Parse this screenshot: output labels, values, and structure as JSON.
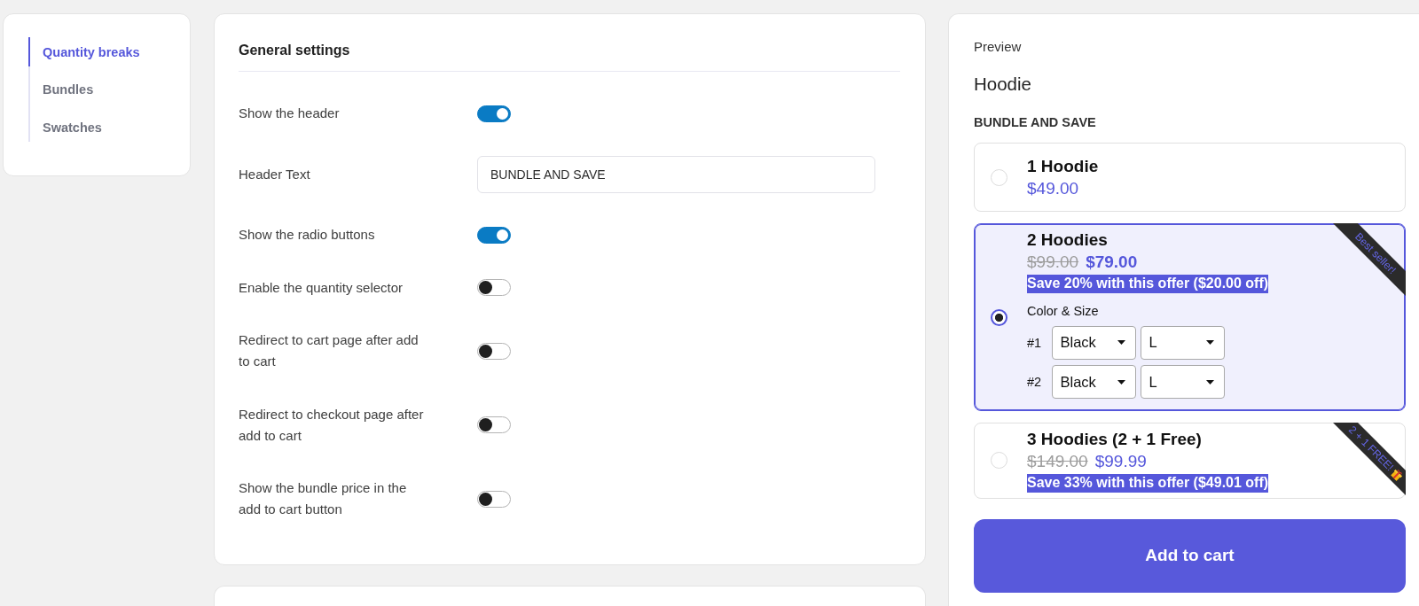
{
  "sidebar": {
    "items": [
      {
        "label": "Quantity breaks",
        "selected": true
      },
      {
        "label": "Bundles",
        "selected": false
      },
      {
        "label": "Swatches",
        "selected": false
      }
    ]
  },
  "settings": {
    "title": "General settings",
    "rows": [
      {
        "kind": "toggle",
        "label": "Show the header",
        "on": true
      },
      {
        "kind": "text",
        "label": "Header Text",
        "value": "BUNDLE AND SAVE"
      },
      {
        "kind": "toggle",
        "label": "Show the radio buttons",
        "on": true
      },
      {
        "kind": "toggle",
        "label": "Enable the quantity selector",
        "on": false
      },
      {
        "kind": "toggle",
        "label": "Redirect to cart page after add to cart",
        "on": false
      },
      {
        "kind": "toggle",
        "label": "Redirect to checkout page after add to cart",
        "on": false
      },
      {
        "kind": "toggle",
        "label": "Show the bundle price in the add to cart button",
        "on": false
      }
    ]
  },
  "preview": {
    "label": "Preview",
    "product_title": "Hoodie",
    "header": "BUNDLE AND SAVE",
    "offers": [
      {
        "title": "1 Hoodie",
        "price": "$49.00",
        "selected": false
      },
      {
        "title": "2 Hoodies",
        "compare_price": "$99.00",
        "price": "$79.00",
        "savings": "Save 20% with this offer ($20.00 off)",
        "ribbon": "Best seller!",
        "ribbon_gift": false,
        "selected": true,
        "variants_label": "Color & Size",
        "variants": [
          {
            "number": "#1",
            "options": [
              "Black",
              "L"
            ]
          },
          {
            "number": "#2",
            "options": [
              "Black",
              "L"
            ]
          }
        ]
      },
      {
        "title": "3 Hoodies (2 + 1 Free)",
        "compare_price": "$149.00",
        "price": "$99.99",
        "savings": "Save 33% with this offer ($49.01 off)",
        "ribbon": "2 + 1 FREE!",
        "ribbon_gift": true,
        "selected": false
      }
    ],
    "button": "Add to cart"
  }
}
